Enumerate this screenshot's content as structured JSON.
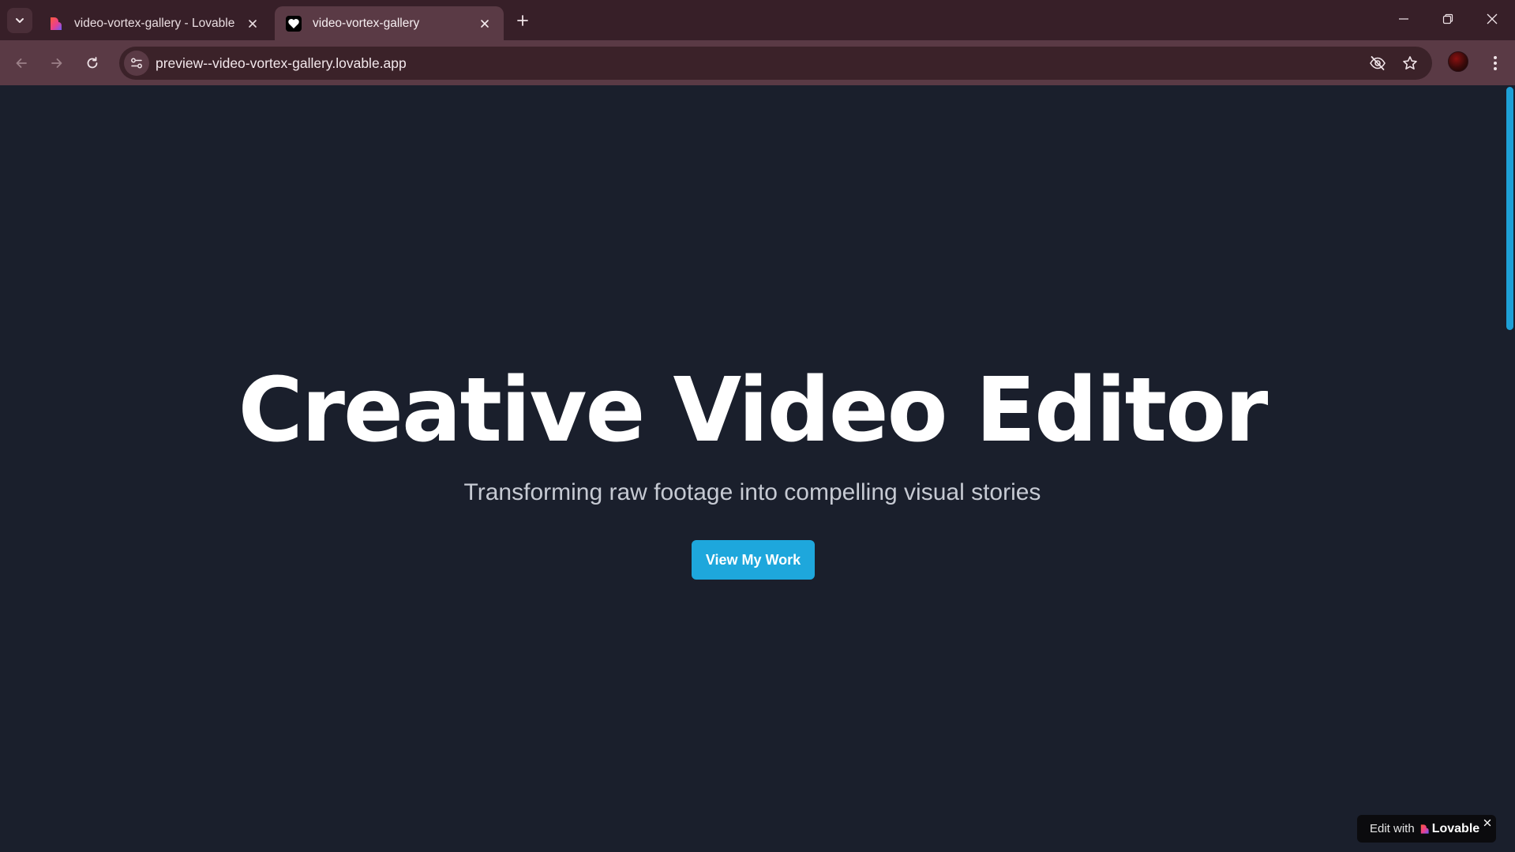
{
  "browser": {
    "tabs": [
      {
        "title": "video-vortex-gallery - Lovable",
        "favicon": "lovable-heart-icon",
        "active": false
      },
      {
        "title": "video-vortex-gallery",
        "favicon": "white-heart-icon",
        "active": true
      }
    ],
    "url": "preview--video-vortex-gallery.lovable.app",
    "icons": {
      "tab_search": "chevron-down-icon",
      "new_tab": "plus-icon",
      "back": "arrow-left-icon",
      "forward": "arrow-right-icon",
      "reload": "reload-icon",
      "site_info": "tune-icon",
      "eye_off": "eye-off-icon",
      "bookmark": "star-icon",
      "menu": "kebab-menu-icon"
    }
  },
  "hero": {
    "title": "Creative Video Editor",
    "subtitle": "Transforming raw footage into compelling visual stories",
    "cta_label": "View My Work"
  },
  "badge": {
    "edit_label": "Edit with",
    "brand": "Lovable"
  },
  "colors": {
    "page_background": "#1a1f2c",
    "accent": "#1ea7dc",
    "tabstrip": "#371f28",
    "toolbar": "#5a3a45"
  }
}
